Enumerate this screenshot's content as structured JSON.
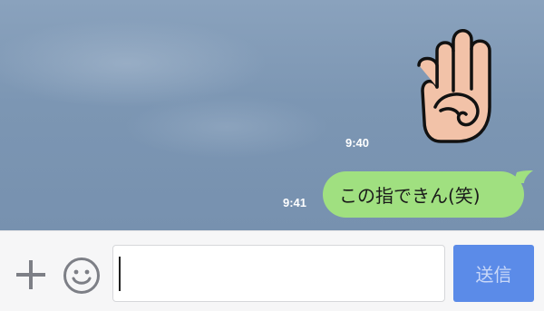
{
  "messages": [
    {
      "type": "sticker",
      "sticker_icon": "hand-four-fingers-sticker",
      "time": "9:40"
    },
    {
      "type": "text",
      "text": "この指できん(笑)",
      "time": "9:41"
    }
  ],
  "input_bar": {
    "plus_icon": "plus-icon",
    "emoji_icon": "smiley-icon",
    "message_value": "",
    "send_label": "送信"
  },
  "colors": {
    "bubble_outgoing": "#a0e080",
    "send_button_disabled": "#5b8be8",
    "chat_background": "#7c96b3"
  }
}
